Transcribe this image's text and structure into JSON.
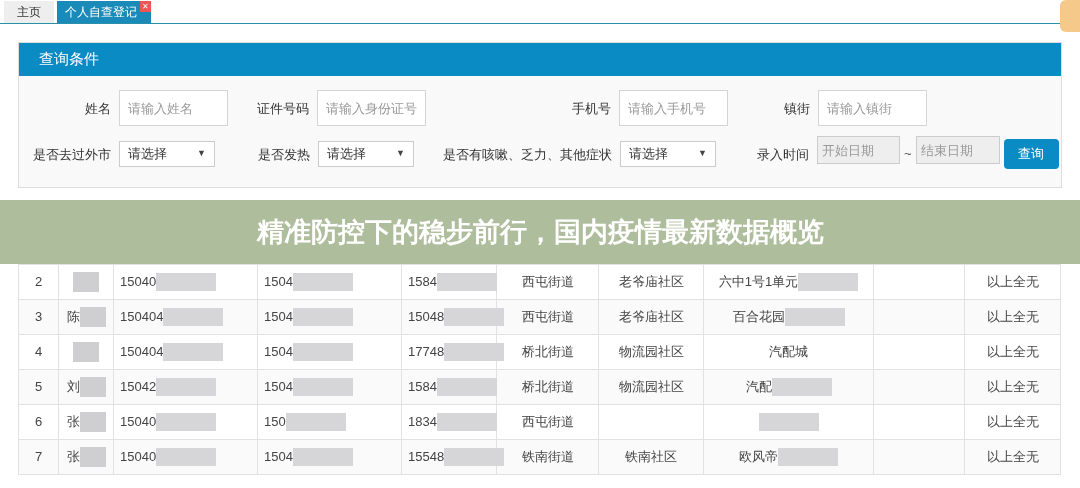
{
  "tabs": [
    {
      "label": "主页",
      "selected": false
    },
    {
      "label": "个人自查登记",
      "selected": true,
      "close_glyph": "✕"
    }
  ],
  "panel": {
    "title": "查询条件",
    "rows": [
      [
        {
          "kind": "text",
          "label": "姓名",
          "placeholder": "请输入姓名"
        },
        {
          "kind": "text",
          "label": "证件号码",
          "placeholder": "请输入身份证号"
        },
        {
          "kind": "text",
          "label": "手机号",
          "placeholder": "请输入手机号"
        },
        {
          "kind": "text",
          "label": "镇街",
          "placeholder": "请输入镇街"
        }
      ],
      [
        {
          "kind": "select",
          "label": "是否去过外市",
          "value": "请选择",
          "caret": "▼"
        },
        {
          "kind": "select",
          "label": "是否发热",
          "value": "请选择",
          "caret": "▼"
        },
        {
          "kind": "select",
          "label": "是否有咳嗽、乏力、其他症状",
          "value": "请选择",
          "caret": "▼"
        },
        {
          "kind": "daterange",
          "label": "录入时间",
          "start_placeholder": "开始日期",
          "separator": "~",
          "end_placeholder": "结束日期"
        }
      ]
    ],
    "button": "查询"
  },
  "banner": {
    "title": "精准防控下的稳步前行，国内疫情最新数据概览"
  },
  "table": {
    "rows": [
      {
        "cells": [
          {
            "text": "2"
          },
          {
            "redacted": true
          },
          {
            "text": "15040",
            "redacted": true
          },
          {
            "text": "1504",
            "redacted": true
          },
          {
            "text": "1584",
            "redacted": true
          },
          {
            "text": "西屯街道"
          },
          {
            "text": "老爷庙社区"
          },
          {
            "text": "六中1号1单元",
            "redacted": true
          },
          {},
          {
            "text": "以上全无"
          }
        ]
      },
      {
        "cells": [
          {
            "text": "3"
          },
          {
            "text": "陈",
            "redacted": true
          },
          {
            "text": "150404",
            "redacted": true
          },
          {
            "text": "1504",
            "redacted": true
          },
          {
            "text": "15048",
            "redacted": true
          },
          {
            "text": "西屯街道"
          },
          {
            "text": "老爷庙社区"
          },
          {
            "text": "百合花园",
            "redacted": true
          },
          {},
          {
            "text": "以上全无"
          }
        ]
      },
      {
        "cells": [
          {
            "text": "4"
          },
          {
            "redacted": true
          },
          {
            "text": "150404",
            "redacted": true
          },
          {
            "text": "1504",
            "redacted": true
          },
          {
            "text": "17748",
            "redacted": true
          },
          {
            "text": "桥北街道"
          },
          {
            "text": "物流园社区"
          },
          {
            "text": "汽配城"
          },
          {},
          {
            "text": "以上全无"
          }
        ]
      },
      {
        "cells": [
          {
            "text": "5"
          },
          {
            "text": "刘",
            "redacted": true
          },
          {
            "text": "15042",
            "redacted": true
          },
          {
            "text": "1504",
            "redacted": true
          },
          {
            "text": "1584",
            "redacted": true
          },
          {
            "text": "桥北街道"
          },
          {
            "text": "物流园社区"
          },
          {
            "text": "汽配",
            "redacted": true
          },
          {},
          {
            "text": "以上全无"
          }
        ]
      },
      {
        "cells": [
          {
            "text": "6"
          },
          {
            "text": "张",
            "redacted": true
          },
          {
            "text": "15040",
            "redacted": true
          },
          {
            "text": "150",
            "redacted": true
          },
          {
            "text": "1834",
            "redacted": true
          },
          {
            "text": "西屯街道"
          },
          {},
          {
            "redacted": true
          },
          {},
          {
            "text": "以上全无"
          }
        ]
      },
      {
        "cells": [
          {
            "text": "7"
          },
          {
            "text": "张",
            "redacted": true
          },
          {
            "text": "15040",
            "redacted": true
          },
          {
            "text": "1504",
            "redacted": true
          },
          {
            "text": "15548",
            "redacted": true
          },
          {
            "text": "铁南街道"
          },
          {
            "text": "铁南社区"
          },
          {
            "text": "欧风帝",
            "redacted": true
          },
          {},
          {
            "text": "以上全无"
          }
        ]
      }
    ]
  }
}
